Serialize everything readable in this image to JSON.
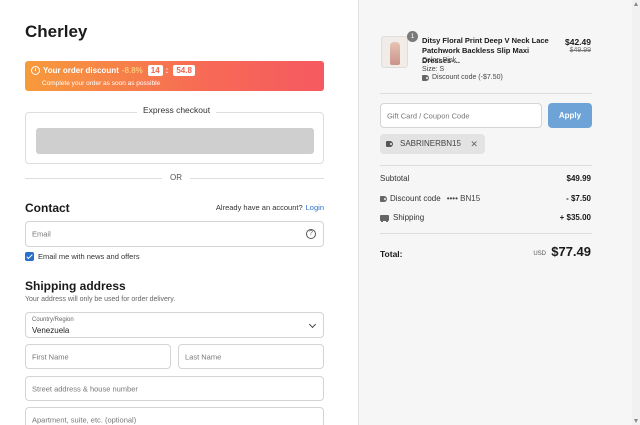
{
  "brand": "Cherley",
  "promo": {
    "label": "Your order discount",
    "percent": "-8.8%",
    "minutes": "14",
    "seconds": "54.8",
    "subtext": "Complete your order as soon as possible",
    "colors": {
      "start": "#f79a3c",
      "end": "#f65a60"
    }
  },
  "express": {
    "title": "Express checkout"
  },
  "divider": {
    "or": "OR"
  },
  "contact": {
    "title": "Contact",
    "account_prompt": "Already have an account?",
    "login": "Login",
    "email_placeholder": "Email",
    "newsletter_label": "Email me with news and offers",
    "newsletter_checked": true
  },
  "shipping": {
    "title": "Shipping address",
    "subtitle": "Your address will only be used for order delivery.",
    "country_label": "Country/Region",
    "country_value": "Venezuela",
    "first_name_placeholder": "First Name",
    "last_name_placeholder": "Last Name",
    "street_placeholder": "Street address & house number",
    "apt_placeholder": "Apartment, suite, etc. (optional)"
  },
  "cart": {
    "item": {
      "quantity": "1",
      "name": "Ditsy Floral Print Deep V Neck Lace Patchwork Backless Slip Maxi Dresses-...",
      "color": "Color: Pink",
      "size": "Size: S",
      "discount": "Discount code (-$7.50)",
      "price": "$42.49",
      "original_price": "$49.99"
    },
    "coupon_placeholder": "Gift Card / Coupon Code",
    "apply_label": "Apply",
    "applied_code": "SABRINERBN15",
    "summary": {
      "subtotal_label": "Subtotal",
      "subtotal_value": "$49.99",
      "discount_label": "Discount code",
      "discount_code_mask": "•••• BN15",
      "discount_value": "- $7.50",
      "shipping_label": "Shipping",
      "shipping_value": "+ $35.00",
      "total_label": "Total:",
      "currency": "USD",
      "total_value": "$77.49"
    },
    "accent_color": "#6ea3d8"
  }
}
